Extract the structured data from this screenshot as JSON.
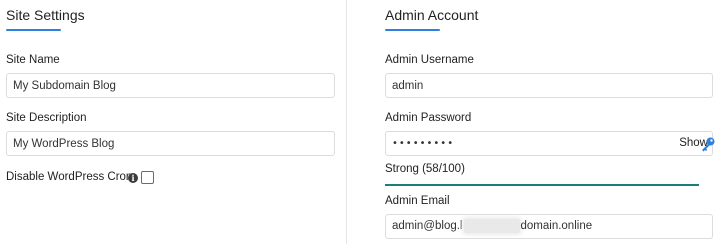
{
  "site_settings": {
    "title": "Site Settings",
    "site_name_label": "Site Name",
    "site_name_value": "My Subdomain Blog",
    "site_description_label": "Site Description",
    "site_description_value": "My WordPress Blog",
    "disable_cron_label": "Disable WordPress Cron",
    "disable_cron_checked": false,
    "info_icon_glyph": "i"
  },
  "admin_account": {
    "title": "Admin Account",
    "username_label": "Admin Username",
    "username_value": "admin",
    "password_label": "Admin Password",
    "password_masked": "•••••••••",
    "show_label": "Show",
    "strength_text": "Strong (58/100)",
    "strength_fraction": 0.58,
    "email_label": "Admin Email",
    "email_prefix": "admin@blog.l",
    "email_suffix": "domain.online"
  },
  "colors": {
    "accent": "#2f7fe0",
    "strength": "#1b7f79",
    "key_icon": "#2f7fe0"
  },
  "icons": {
    "info": "info-icon",
    "key": "key-icon"
  }
}
